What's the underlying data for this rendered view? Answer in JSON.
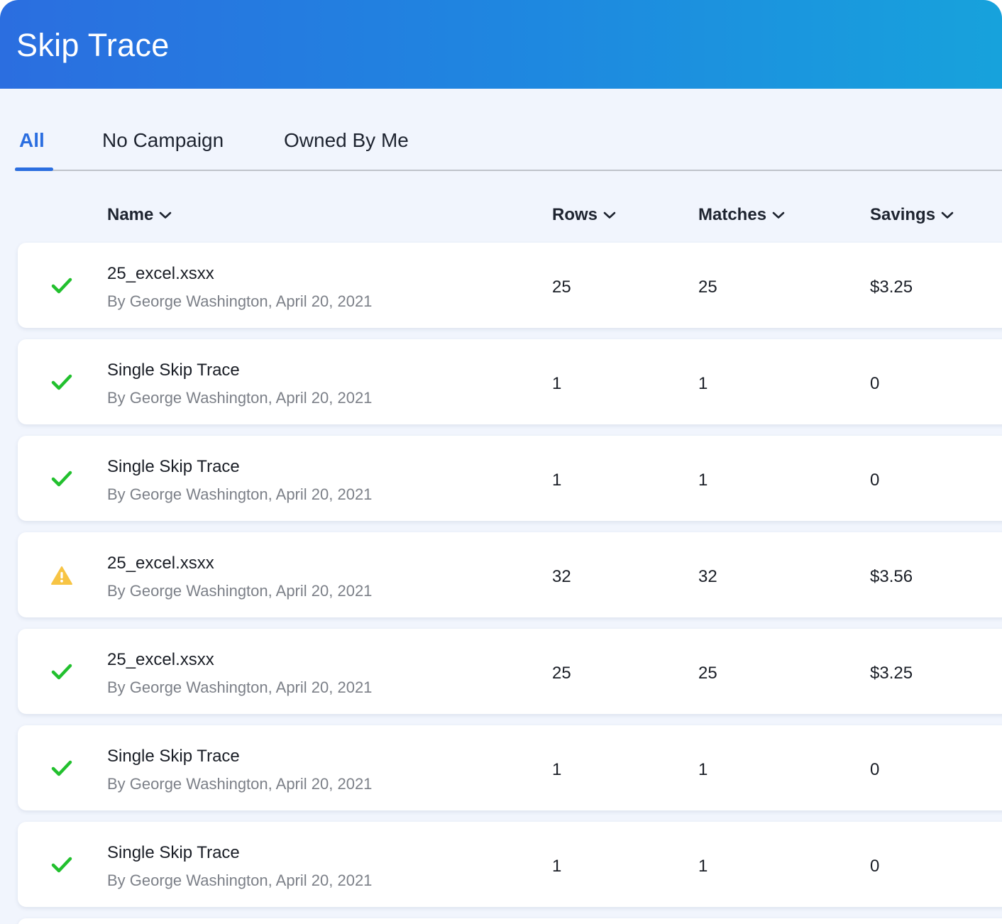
{
  "app": {
    "title": "Skip Trace"
  },
  "tabs": [
    {
      "label": "All",
      "active": true
    },
    {
      "label": "No Campaign",
      "active": false
    },
    {
      "label": "Owned By Me",
      "active": false
    }
  ],
  "columns": {
    "name": "Name",
    "rows": "Rows",
    "matches": "Matches",
    "savings": "Savings",
    "sort_icon": "chevron-down-icon"
  },
  "colors": {
    "accent": "#2b6ee0",
    "header_gradient_start": "#2b6ee0",
    "header_gradient_end": "#17a2dc",
    "success": "#22c02e",
    "warning": "#f7c444"
  },
  "jobs": [
    {
      "status": "success",
      "status_icon": "check-icon",
      "name": "25_excel.xsxx",
      "meta": "By George Washington, April 20, 2021",
      "rows": "25",
      "matches": "25",
      "savings": "$3.25"
    },
    {
      "status": "success",
      "status_icon": "check-icon",
      "name": "Single Skip Trace",
      "meta": "By George Washington, April 20, 2021",
      "rows": "1",
      "matches": "1",
      "savings": "0"
    },
    {
      "status": "success",
      "status_icon": "check-icon",
      "name": "Single Skip Trace",
      "meta": "By George Washington, April 20, 2021",
      "rows": "1",
      "matches": "1",
      "savings": "0"
    },
    {
      "status": "warning",
      "status_icon": "warning-icon",
      "name": "25_excel.xsxx",
      "meta": "By George Washington, April 20, 2021",
      "rows": "32",
      "matches": "32",
      "savings": "$3.56"
    },
    {
      "status": "success",
      "status_icon": "check-icon",
      "name": "25_excel.xsxx",
      "meta": "By George Washington, April 20, 2021",
      "rows": "25",
      "matches": "25",
      "savings": "$3.25"
    },
    {
      "status": "success",
      "status_icon": "check-icon",
      "name": "Single Skip Trace",
      "meta": "By George Washington, April 20, 2021",
      "rows": "1",
      "matches": "1",
      "savings": "0"
    },
    {
      "status": "success",
      "status_icon": "check-icon",
      "name": "Single Skip Trace",
      "meta": "By George Washington, April 20, 2021",
      "rows": "1",
      "matches": "1",
      "savings": "0"
    }
  ]
}
